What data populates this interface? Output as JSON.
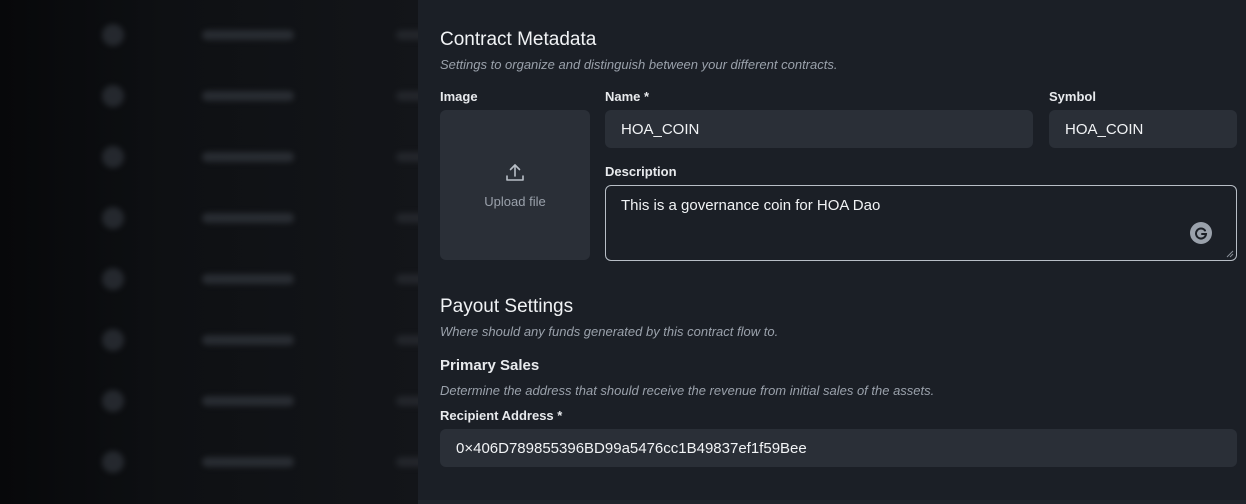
{
  "metadata": {
    "title": "Contract Metadata",
    "subtitle": "Settings to organize and distinguish between your different contracts.",
    "image_label": "Image",
    "upload_label": "Upload file",
    "name_label": "Name *",
    "name_value": "HOA_COIN",
    "symbol_label": "Symbol",
    "symbol_value": "HOA_COIN",
    "description_label": "Description",
    "description_value": "This is a governance coin for HOA Dao"
  },
  "payout": {
    "title": "Payout Settings",
    "subtitle": "Where should any funds generated by this contract flow to.",
    "primary_sales_label": "Primary Sales",
    "primary_sales_sub": "Determine the address that should receive the revenue from initial sales of the assets.",
    "recipient_label": "Recipient Address *",
    "recipient_value": "0×406D789855396BD99a5476cc1B49837ef1f59Bee"
  },
  "colors": {
    "drawer_bg": "#1b1f26",
    "input_bg": "#2a2f37",
    "backdrop": "#0b0c0f"
  }
}
